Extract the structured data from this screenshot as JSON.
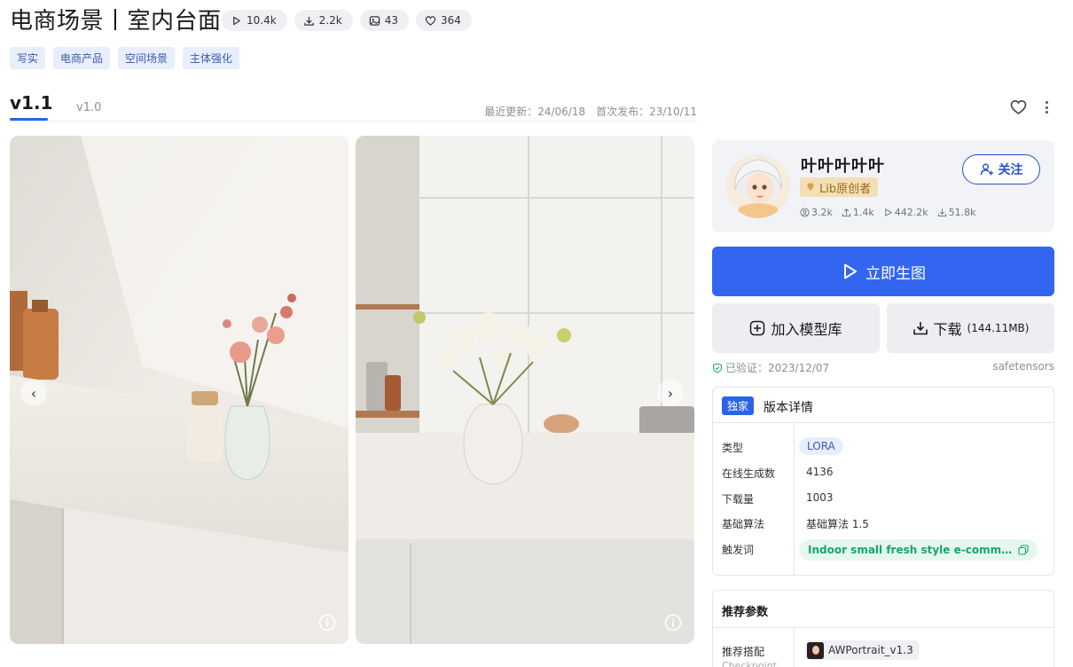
{
  "title": "电商场景丨室内台面",
  "stats": {
    "runs": "10.4k",
    "downloads": "2.2k",
    "images": "43",
    "likes": "364"
  },
  "tags": [
    "写实",
    "电商产品",
    "空间场景",
    "主体强化"
  ],
  "versions": {
    "active": "v1.1",
    "other": "v1.0",
    "last_updated": "最近更新：24/06/18",
    "first_published": "首次发布：23/10/11"
  },
  "creator": {
    "name": "叶叶叶叶叶",
    "badge": "Lib原创者",
    "followers": "3.2k",
    "downloads": "1.4k",
    "runs": "442.2k",
    "models": "51.8k",
    "follow_label": "关注"
  },
  "actions": {
    "generate": "立即生图",
    "add_library": "加入模型库",
    "download": "下载",
    "download_size": "(144.11MB)"
  },
  "verify": {
    "text": "已验证：2023/12/07",
    "format": "safetensors"
  },
  "details": {
    "exclusive": "独家",
    "title": "版本详情",
    "rows": [
      {
        "label": "类型",
        "value": "LORA"
      },
      {
        "label": "在线生成数",
        "value": "4136"
      },
      {
        "label": "下载量",
        "value": "1003"
      },
      {
        "label": "基础算法",
        "value": "基础算法 1.5"
      },
      {
        "label": "触发词",
        "value": "Indoor small fresh style e-commerce background"
      }
    ]
  },
  "recommend": {
    "title": "推荐参数",
    "label": "推荐搭配",
    "sublabel": "Checkpoint",
    "model": "AWPortrait_v1.3"
  },
  "colors": {
    "primary": "#3366f0",
    "tag_bg": "#e8eefb",
    "trigger_green": "#17a66a"
  }
}
